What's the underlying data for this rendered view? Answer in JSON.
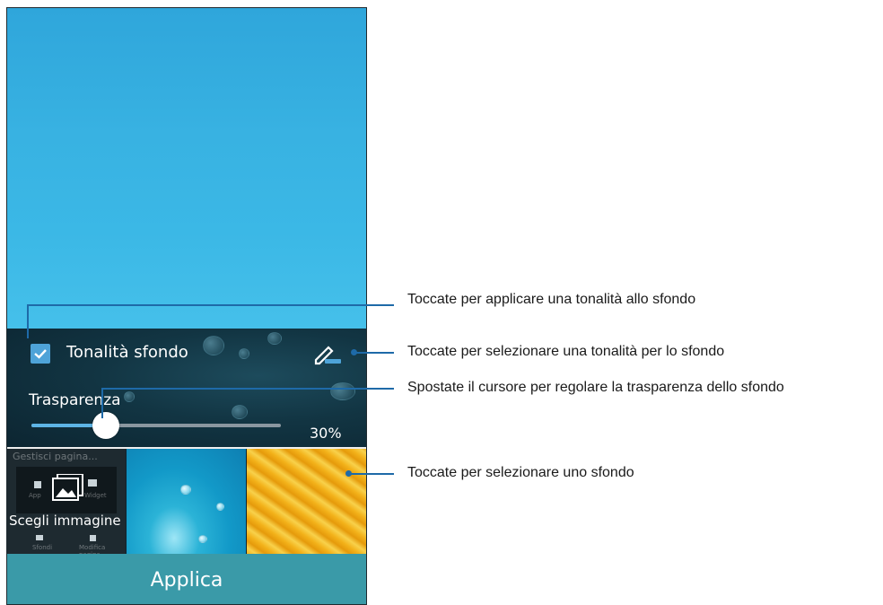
{
  "phone": {
    "tint_label": "Tonalità sfondo",
    "tint_checked": true,
    "transparency_label": "Trasparenza",
    "transparency_value": "30%",
    "transparency_fraction": 0.3,
    "thumbnails": {
      "choose_image_label": "Scegli immagine",
      "ghost_title": "Gestisci pagina...",
      "ghost_app": "App",
      "ghost_widget": "Widget",
      "ghost_sfondi": "Sfondi",
      "ghost_modifica": "Modifica pagina"
    },
    "apply_label": "Applica"
  },
  "callouts": [
    {
      "text": "Toccate per applicare una tonalità allo sfondo"
    },
    {
      "text": "Toccate per selezionare una tonalità per lo sfondo"
    },
    {
      "text": "Spostate il cursore per regolare la trasparenza dello sfondo"
    },
    {
      "text": "Toccate per selezionare uno sfondo"
    }
  ],
  "colors": {
    "accent_blue": "#4ea3d8",
    "callout_line": "#1e6aa8",
    "apply_bar": "#3a9aa8"
  },
  "icons": [
    "check-icon",
    "edit-pencil-icon",
    "apps-grid-icon",
    "image-icon",
    "widget-icon"
  ]
}
